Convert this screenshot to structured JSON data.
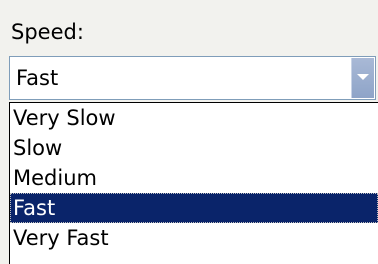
{
  "speed_label": "Speed:",
  "combo": {
    "value": "Fast",
    "arrow_icon": "chevron-down-icon"
  },
  "dropdown": {
    "options": [
      "Very Slow",
      "Slow",
      "Medium",
      "Fast",
      "Very Fast"
    ],
    "selected_index": 3
  },
  "colors": {
    "selection_background": "#0a246a",
    "selection_text": "#ffffff",
    "combo_border": "#7f9db9",
    "arrow_button": "#99abcf"
  }
}
